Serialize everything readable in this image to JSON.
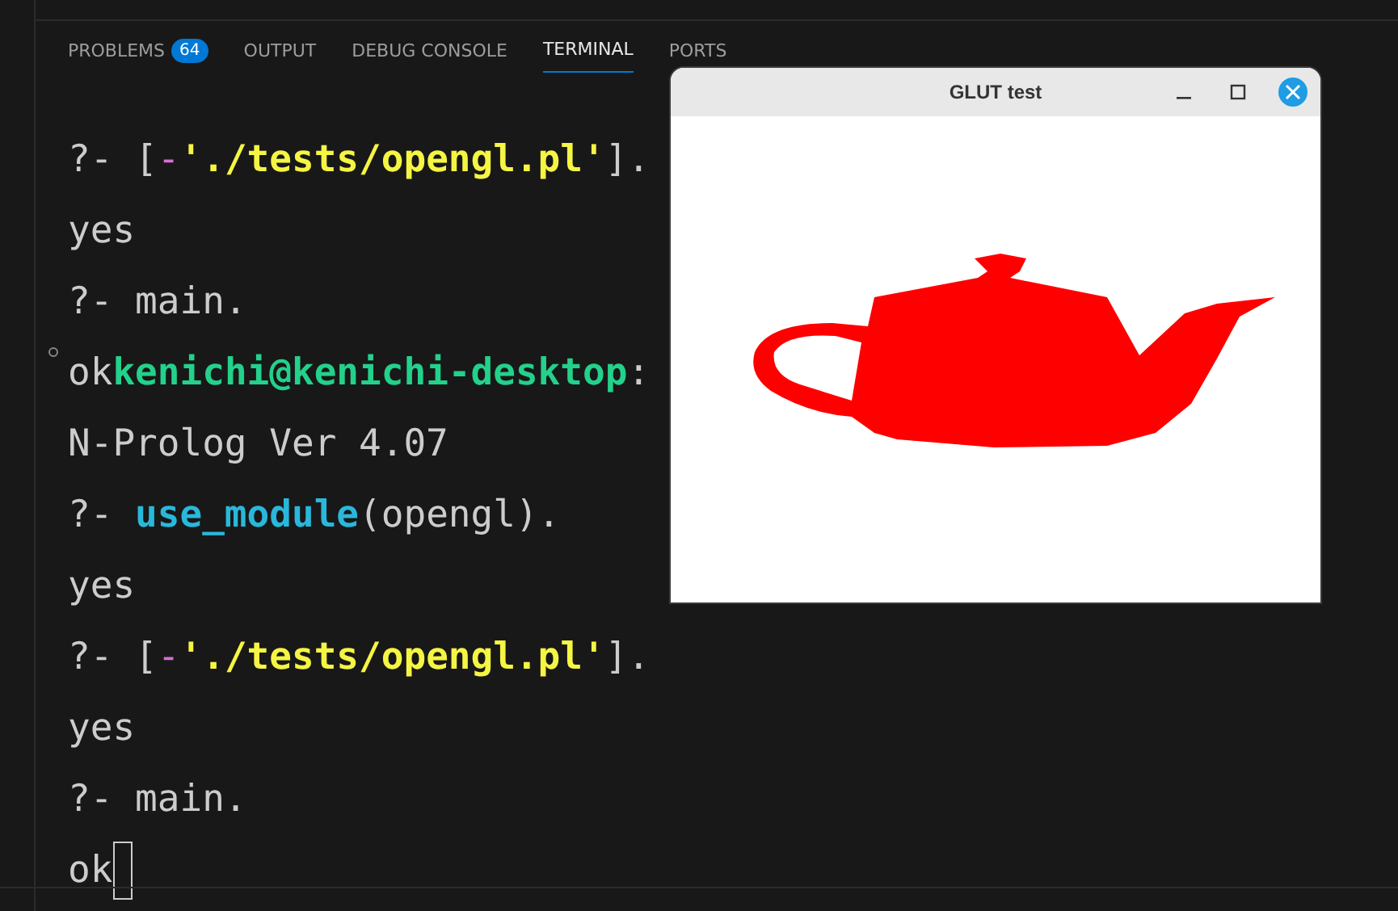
{
  "panel_tabs": [
    {
      "label": "PROBLEMS",
      "badge": "64",
      "selected": false
    },
    {
      "label": "OUTPUT",
      "selected": false
    },
    {
      "label": "DEBUG CONSOLE",
      "selected": false
    },
    {
      "label": "TERMINAL",
      "selected": true
    },
    {
      "label": "PORTS",
      "selected": false
    }
  ],
  "terminal": {
    "lines": [
      [
        {
          "kind": "plain",
          "text": "?- ["
        },
        {
          "kind": "operator",
          "text": "-"
        },
        {
          "kind": "string",
          "text": "'./tests/opengl.pl'"
        },
        {
          "kind": "plain",
          "text": "]."
        }
      ],
      [
        {
          "kind": "plain",
          "text": "yes"
        }
      ],
      [
        {
          "kind": "plain",
          "text": "?- main."
        }
      ],
      [
        {
          "kind": "plain",
          "text": "ok"
        },
        {
          "kind": "user",
          "text": "kenichi@kenichi-desktop"
        },
        {
          "kind": "plain",
          "text": ":"
        }
      ],
      [
        {
          "kind": "plain",
          "text": "N-Prolog Ver 4.07"
        }
      ],
      [
        {
          "kind": "plain",
          "text": "?- "
        },
        {
          "kind": "keyword",
          "text": "use_module"
        },
        {
          "kind": "plain",
          "text": "(opengl)."
        }
      ],
      [
        {
          "kind": "plain",
          "text": "yes"
        }
      ],
      [
        {
          "kind": "plain",
          "text": "?- ["
        },
        {
          "kind": "operator",
          "text": "-"
        },
        {
          "kind": "string",
          "text": "'./tests/opengl.pl'"
        },
        {
          "kind": "plain",
          "text": "]."
        }
      ],
      [
        {
          "kind": "plain",
          "text": "yes"
        }
      ],
      [
        {
          "kind": "plain",
          "text": "?- main."
        }
      ],
      [
        {
          "kind": "plain",
          "text": "ok"
        },
        {
          "kind": "cursor"
        }
      ]
    ]
  },
  "glut_window": {
    "title": "GLUT test"
  }
}
